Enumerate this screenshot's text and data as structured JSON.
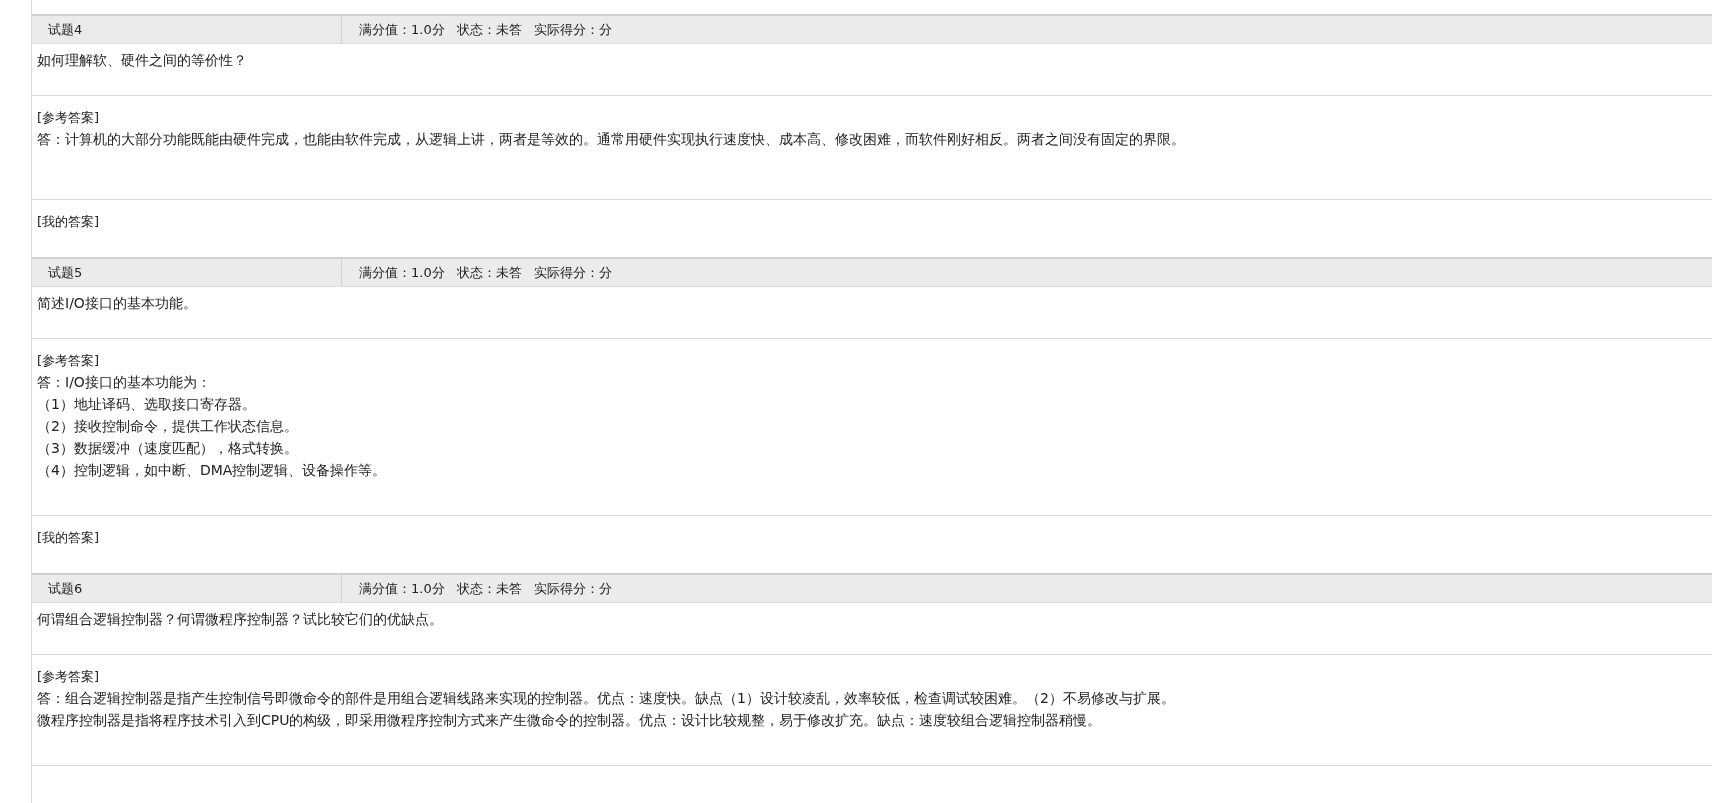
{
  "questions": [
    {
      "title": "试题4",
      "info": "满分值：1.0分   状态：未答   实际得分：分",
      "question": "如何理解软、硬件之间的等价性？",
      "reference_label": "[参考答案]",
      "reference_lines": [
        "答：计算机的大部分功能既能由硬件完成，也能由软件完成，从逻辑上讲，两者是等效的。通常用硬件实现执行速度快、成本高、修改困难，而软件刚好相反。两者之间没有固定的界限。"
      ],
      "my_answer_label": "[我的答案]"
    },
    {
      "title": "试题5",
      "info": "满分值：1.0分   状态：未答   实际得分：分",
      "question": "简述I/O接口的基本功能。",
      "reference_label": "[参考答案]",
      "reference_lines": [
        "答：I/O接口的基本功能为：",
        "（1）地址译码、选取接口寄存器。",
        "（2）接收控制命令，提供工作状态信息。",
        "（3）数据缓冲（速度匹配），格式转换。",
        "（4）控制逻辑，如中断、DMA控制逻辑、设备操作等。"
      ],
      "my_answer_label": "[我的答案]"
    },
    {
      "title": "试题6",
      "info": "满分值：1.0分   状态：未答   实际得分：分",
      "question": "何谓组合逻辑控制器？何谓微程序控制器？试比较它们的优缺点。",
      "reference_label": "[参考答案]",
      "reference_lines": [
        "答：组合逻辑控制器是指产生控制信号即微命令的部件是用组合逻辑线路来实现的控制器。优点：速度快。缺点（1）设计较凌乱，效率较低，检查调试较困难。（2）不易修改与扩展。",
        "微程序控制器是指将程序技术引入到CPU的构级，即采用微程序控制方式来产生微命令的控制器。优点：设计比较规整，易于修改扩充。缺点：速度较组合逻辑控制器稍慢。"
      ]
    }
  ]
}
